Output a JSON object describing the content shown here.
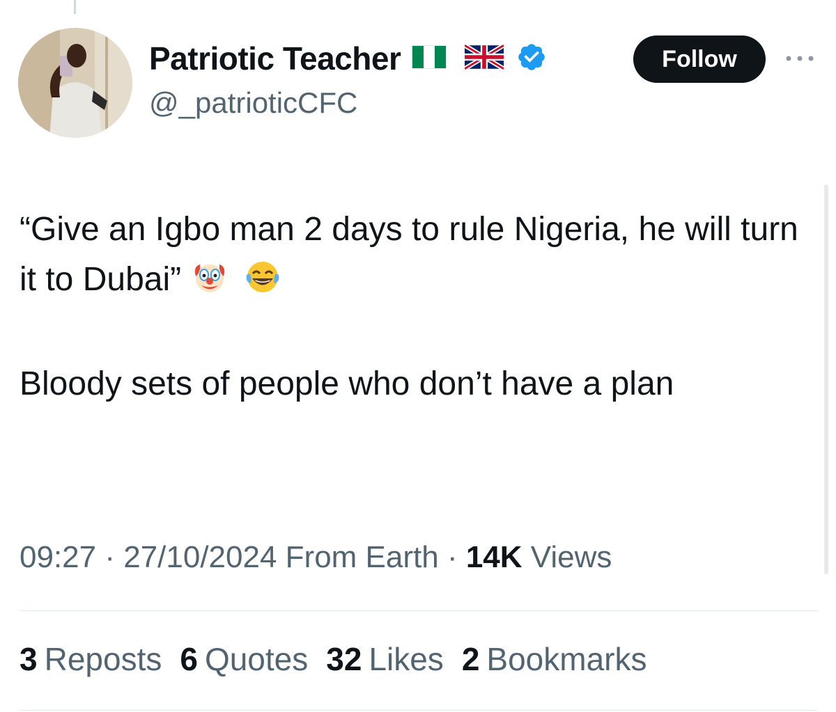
{
  "author": {
    "display_name": "Patriotic Teacher",
    "handle": "@_patrioticCFC",
    "flags": [
      "nigeria-flag",
      "uk-flag"
    ],
    "verified": true
  },
  "follow_label": "Follow",
  "tweet": {
    "line1": "“Give an Igbo man 2 days to rule Nigeria, he will turn it to Dubai”",
    "line1_emojis": [
      "clown-face-emoji",
      "tears-of-joy-emoji"
    ],
    "line2": "Bloody sets of people who don’t have a plan"
  },
  "meta": {
    "time": "09:27",
    "sep1": " · ",
    "date": "27/10/2024",
    "source": " From Earth",
    "sep2": " · ",
    "views_count": "14K",
    "views_label": " Views"
  },
  "stats": {
    "reposts": {
      "count": "3",
      "label": "Reposts"
    },
    "quotes": {
      "count": "6",
      "label": "Quotes"
    },
    "likes": {
      "count": "32",
      "label": "Likes"
    },
    "bookmarks": {
      "count": "2",
      "label": "Bookmarks"
    }
  },
  "colors": {
    "text": "#0f1419",
    "secondary": "#536471",
    "verified_blue": "#1d9bf0",
    "divider": "#e1e8ed"
  }
}
